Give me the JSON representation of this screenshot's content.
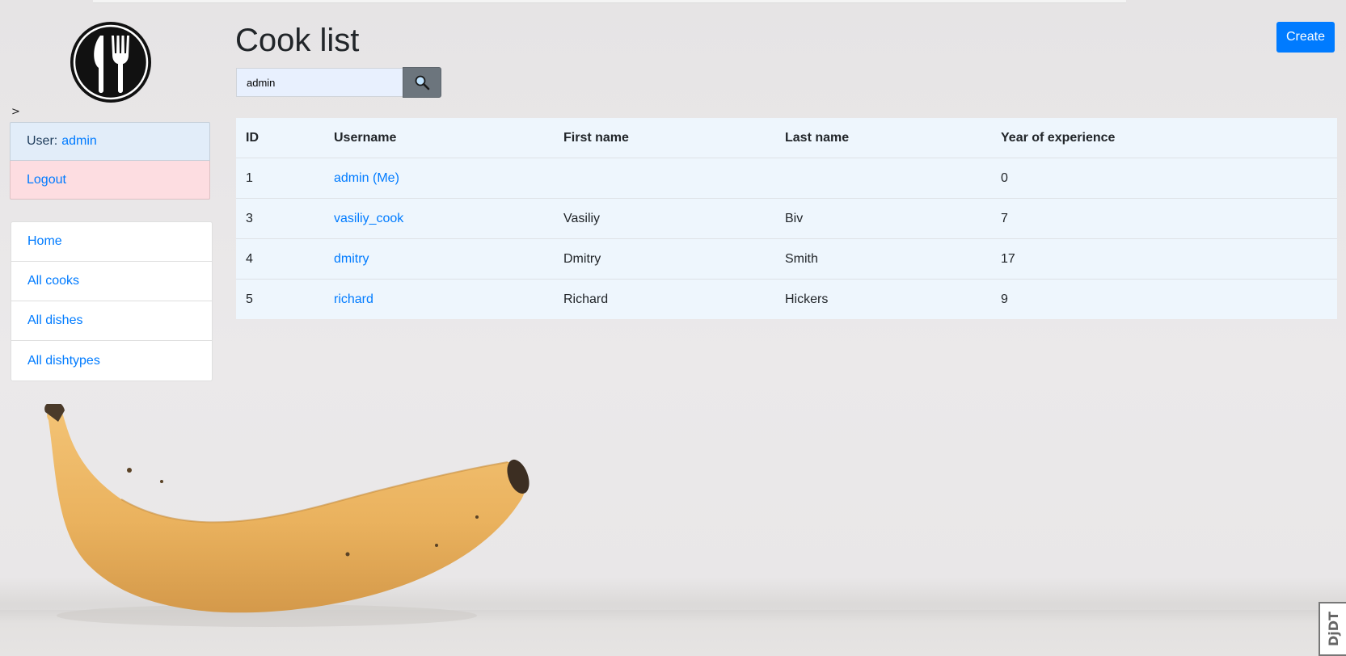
{
  "brand": {
    "logo_icon": "fork-knife-logo-icon"
  },
  "sidebar": {
    "caret": ">",
    "user_prefix": "User:",
    "username": "admin",
    "logout_label": "Logout",
    "nav": [
      {
        "label": "Home"
      },
      {
        "label": "All cooks"
      },
      {
        "label": "All dishes"
      },
      {
        "label": "All dishtypes"
      }
    ]
  },
  "main": {
    "title": "Cook list",
    "create_label": "Create",
    "search": {
      "value": "admin",
      "button_icon": "search-icon"
    },
    "table": {
      "columns": [
        "ID",
        "Username",
        "First name",
        "Last name",
        "Year of experience"
      ],
      "rows": [
        {
          "id": "1",
          "username": "admin (Me)",
          "first_name": "",
          "last_name": "",
          "years": "0"
        },
        {
          "id": "3",
          "username": "vasiliy_cook",
          "first_name": "Vasiliy",
          "last_name": "Biv",
          "years": "7"
        },
        {
          "id": "4",
          "username": "dmitry",
          "first_name": "Dmitry",
          "last_name": "Smith",
          "years": "17"
        },
        {
          "id": "5",
          "username": "richard",
          "first_name": "Richard",
          "last_name": "Hickers",
          "years": "9"
        }
      ]
    }
  },
  "debug_toolbar": {
    "label": "DjDT"
  },
  "colors": {
    "primary": "#007bff",
    "secondary": "#6c757d",
    "user_bg": "#e2edf9",
    "logout_bg": "#fddde1",
    "table_bg": "#eef6fd"
  }
}
